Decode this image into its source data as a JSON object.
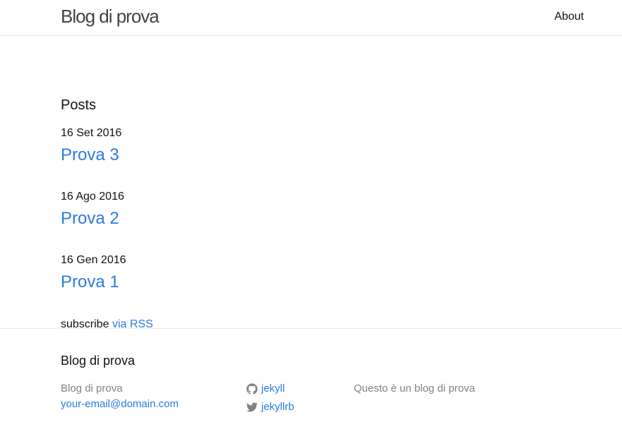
{
  "header": {
    "site_title": "Blog di prova",
    "nav": [
      {
        "label": "About"
      }
    ]
  },
  "main": {
    "heading": "Posts",
    "posts": [
      {
        "date": "16 Set 2016",
        "title": "Prova 3"
      },
      {
        "date": "16 Ago 2016",
        "title": "Prova 2"
      },
      {
        "date": "16 Gen 2016",
        "title": "Prova 1"
      }
    ],
    "rss": {
      "prefix": "subscribe",
      "link_label": "via RSS"
    }
  },
  "footer": {
    "heading": "Blog di prova",
    "col1": {
      "name": "Blog di prova",
      "email": "your-email@domain.com"
    },
    "col2": {
      "github": {
        "icon": "github-icon",
        "label": "jekyll"
      },
      "twitter": {
        "icon": "twitter-icon",
        "label": "jekyllrb"
      }
    },
    "col3": {
      "description": "Questo è un blog di prova"
    }
  },
  "colors": {
    "link": "#2a7ae2",
    "muted": "#828282",
    "border": "#e8e8e8"
  }
}
